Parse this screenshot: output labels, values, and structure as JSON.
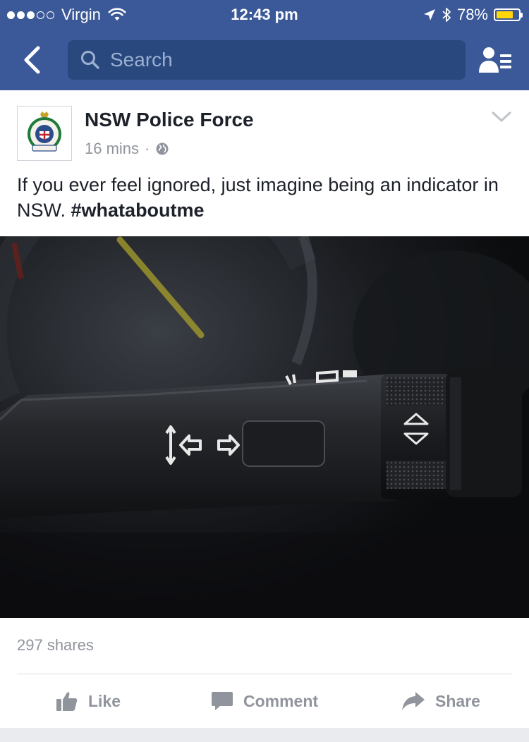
{
  "status_bar": {
    "carrier": "Virgin",
    "signal_bars_filled": 3,
    "signal_bars_total": 5,
    "time": "12:43 pm",
    "battery_percent": "78%",
    "battery_level": 0.78,
    "battery_color": "#ffd60a"
  },
  "nav": {
    "search_placeholder": "Search",
    "back_icon": "chevron-left-icon",
    "friends_icon": "friend-requests-icon",
    "bar_color": "#3b5998"
  },
  "post": {
    "page_name": "NSW Police Force",
    "time_ago": "16 mins",
    "separator": "·",
    "privacy_icon": "globe-icon",
    "text": "If you ever feel ignored, just imagine being an indicator in NSW.",
    "hashtag": "#whataboutme",
    "photo_subject": "car turn-signal indicator stalk"
  },
  "engagement": {
    "shares": "297 shares"
  },
  "actions": {
    "like": "Like",
    "comment": "Comment",
    "share": "Share"
  }
}
